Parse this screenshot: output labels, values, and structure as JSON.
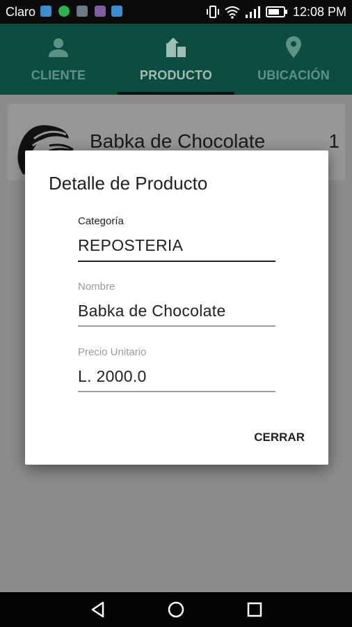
{
  "status_bar": {
    "carrier": "Claro",
    "time": "12:08 PM"
  },
  "tabs": [
    {
      "label": "CLIENTE",
      "icon": "person-icon",
      "active": false
    },
    {
      "label": "PRODUCTO",
      "icon": "product-icon",
      "active": true
    },
    {
      "label": "UBICACIÓN",
      "icon": "location-pin-icon",
      "active": false
    }
  ],
  "product_card": {
    "name": "Babka de Chocolate",
    "quantity": "1"
  },
  "dialog": {
    "title": "Detalle de Producto",
    "fields": [
      {
        "label": "Categoría",
        "value": "REPOSTERIA"
      },
      {
        "label": "Nombre",
        "value": "Babka de Chocolate"
      },
      {
        "label": "Precio Unitario",
        "value": "L. 2000.0"
      }
    ],
    "close_label": "CERRAR"
  },
  "colors": {
    "app_bar": "#0d4d40",
    "status_bar": "#0b0b0b",
    "nav_bar": "#050505",
    "scrim": "#8c8c8c",
    "dialog_bg": "#ffffff"
  }
}
